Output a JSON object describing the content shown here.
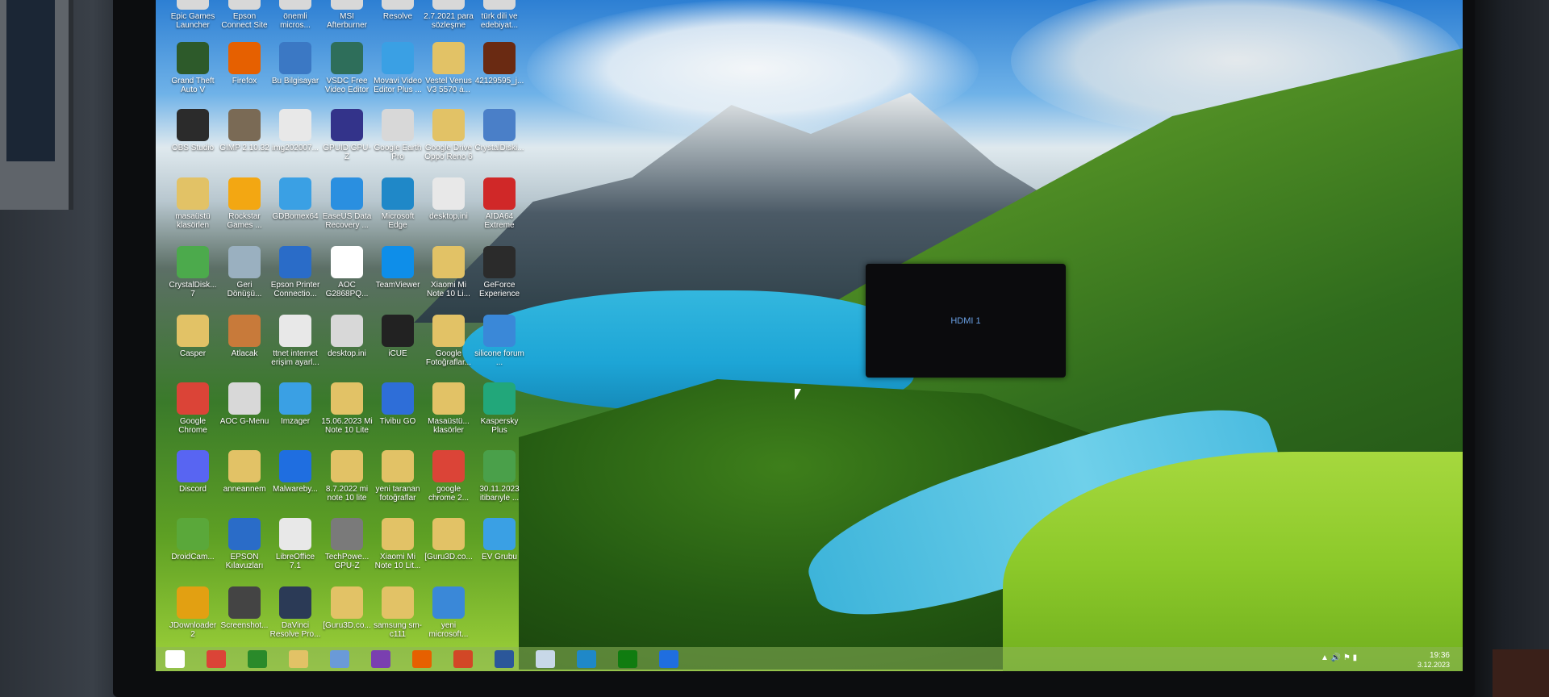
{
  "osd": {
    "label": "HDMI 1"
  },
  "taskbar": {
    "time": "19:36",
    "date": "3.12.2023",
    "pinned": [
      "start",
      "chrome",
      "store",
      "explorer",
      "control-panel",
      "onenote",
      "firefox",
      "powerpoint",
      "word",
      "notepad",
      "edge",
      "xbox",
      "malwarebytes"
    ]
  },
  "colors": {
    "osd_text": "#6aa0e4",
    "taskbar": "#8cb45a"
  },
  "icons": [
    {
      "col": 0,
      "row": 0,
      "label": "Epic Games Launcher"
    },
    {
      "col": 1,
      "row": 0,
      "label": "Epson Connect Site"
    },
    {
      "col": 2,
      "row": 0,
      "label": "önemli micros..."
    },
    {
      "col": 3,
      "row": 0,
      "label": "MSI Afterburner"
    },
    {
      "col": 4,
      "row": 0,
      "label": "Resolve"
    },
    {
      "col": 5,
      "row": 0,
      "label": "2.7.2021 para sözleşme"
    },
    {
      "col": 6,
      "row": 0,
      "label": "türk dili ve edebiyat..."
    },
    {
      "col": 0,
      "row": 1,
      "label": "Grand Theft Auto V",
      "color": "#2d5a2a"
    },
    {
      "col": 1,
      "row": 1,
      "label": "Firefox",
      "color": "#e66000"
    },
    {
      "col": 2,
      "row": 1,
      "label": "Bu Bilgisayar",
      "color": "#3b78c4"
    },
    {
      "col": 3,
      "row": 1,
      "label": "VSDC Free Video Editor",
      "color": "#2e6e5a"
    },
    {
      "col": 4,
      "row": 1,
      "label": "Movavi Video Editor Plus ...",
      "color": "#3aa0e4"
    },
    {
      "col": 5,
      "row": 1,
      "label": "Vestel Venus V3 5570 á...",
      "color": "#e2c266"
    },
    {
      "col": 6,
      "row": 1,
      "label": "42129595_j...",
      "color": "#6a2a12"
    },
    {
      "col": 0,
      "row": 2,
      "label": "OBS Studio",
      "color": "#2b2b2b"
    },
    {
      "col": 1,
      "row": 2,
      "label": "GIMP 2.10.32",
      "color": "#7a6a55"
    },
    {
      "col": 2,
      "row": 2,
      "label": "img202007...",
      "color": "#e8e8e8"
    },
    {
      "col": 3,
      "row": 2,
      "label": "GPUID GPU-Z",
      "color": "#33338a"
    },
    {
      "col": 4,
      "row": 2,
      "label": "Google Earth Pro",
      "color": "#d8d8d8"
    },
    {
      "col": 5,
      "row": 2,
      "label": "Google Drive Oppo Reno 6",
      "color": "#e2c266"
    },
    {
      "col": 6,
      "row": 2,
      "label": "CrystalDiski...",
      "color": "#4a7fc8"
    },
    {
      "col": 0,
      "row": 3,
      "label": "masaüstü klasörlen",
      "color": "#e2c266"
    },
    {
      "col": 1,
      "row": 3,
      "label": "Rockstar Games ...",
      "color": "#f3a712"
    },
    {
      "col": 2,
      "row": 3,
      "label": "GDBomex64",
      "color": "#3aa0e4"
    },
    {
      "col": 3,
      "row": 3,
      "label": "EaseUS Data Recovery ...",
      "color": "#2a8fe0"
    },
    {
      "col": 4,
      "row": 3,
      "label": "Microsoft Edge",
      "color": "#1f88c8"
    },
    {
      "col": 5,
      "row": 3,
      "label": "desktop.ini",
      "color": "#e8e8e8"
    },
    {
      "col": 6,
      "row": 3,
      "label": "AIDA64 Extreme",
      "color": "#d02828"
    },
    {
      "col": 0,
      "row": 4,
      "label": "CrystalDisk... 7",
      "color": "#4caa4c"
    },
    {
      "col": 1,
      "row": 4,
      "label": "Geri Dönüşü...",
      "color": "#9ab0c0"
    },
    {
      "col": 2,
      "row": 4,
      "label": "Epson Printer Connectio...",
      "color": "#2a6cc8"
    },
    {
      "col": 3,
      "row": 4,
      "label": "AOC G2868PQ...",
      "color": "#ffffff"
    },
    {
      "col": 4,
      "row": 4,
      "label": "TeamViewer",
      "color": "#0e8ee9"
    },
    {
      "col": 5,
      "row": 4,
      "label": "Xiaomi Mi Note 10 Li...",
      "color": "#e2c266"
    },
    {
      "col": 6,
      "row": 4,
      "label": "GeForce Experience",
      "color": "#2b2b2b"
    },
    {
      "col": 0,
      "row": 5,
      "label": "Casper",
      "color": "#e2c266"
    },
    {
      "col": 1,
      "row": 5,
      "label": "Atlacak",
      "color": "#c87a3a"
    },
    {
      "col": 2,
      "row": 5,
      "label": "ttnet internet erişim ayarl...",
      "color": "#e8e8e8"
    },
    {
      "col": 3,
      "row": 5,
      "label": "desktop.ini",
      "color": "#d8d8d8"
    },
    {
      "col": 4,
      "row": 5,
      "label": "iCUE",
      "color": "#222222"
    },
    {
      "col": 5,
      "row": 5,
      "label": "Google Fotoğraflar...",
      "color": "#e2c266"
    },
    {
      "col": 6,
      "row": 5,
      "label": "silicone forum ...",
      "color": "#3a88d8"
    },
    {
      "col": 0,
      "row": 6,
      "label": "Google Chrome",
      "color": "#db4437"
    },
    {
      "col": 1,
      "row": 6,
      "label": "AOC G-Menu",
      "color": "#d8d8d8"
    },
    {
      "col": 2,
      "row": 6,
      "label": "Imzager",
      "color": "#3aa0e4"
    },
    {
      "col": 3,
      "row": 6,
      "label": "15.06.2023 Mi Note 10 Lite",
      "color": "#e2c266"
    },
    {
      "col": 4,
      "row": 6,
      "label": "Tivibu GO",
      "color": "#2e6ed8"
    },
    {
      "col": 5,
      "row": 6,
      "label": "Masaüstü... klasörler",
      "color": "#e2c266"
    },
    {
      "col": 6,
      "row": 6,
      "label": "Kaspersky Plus",
      "color": "#22a77a"
    },
    {
      "col": 0,
      "row": 7,
      "label": "Discord",
      "color": "#5865f2"
    },
    {
      "col": 1,
      "row": 7,
      "label": "anneannem",
      "color": "#e2c266"
    },
    {
      "col": 2,
      "row": 7,
      "label": "Malwareby...",
      "color": "#1f6ee0"
    },
    {
      "col": 3,
      "row": 7,
      "label": "8.7.2022 mi note 10 lite",
      "color": "#e2c266"
    },
    {
      "col": 4,
      "row": 7,
      "label": "yeni taranan fotoğraflar",
      "color": "#e2c266"
    },
    {
      "col": 5,
      "row": 7,
      "label": "google chrome 2...",
      "color": "#db4437"
    },
    {
      "col": 6,
      "row": 7,
      "label": "30.11.2023 itibarıyle ...",
      "color": "#4aa04a"
    },
    {
      "col": 0,
      "row": 8,
      "label": "DroidCam...",
      "color": "#5aa83a"
    },
    {
      "col": 1,
      "row": 8,
      "label": "EPSON Kılavuzları",
      "color": "#2a6cc8"
    },
    {
      "col": 2,
      "row": 8,
      "label": "LibreOffice 7.1",
      "color": "#e8e8e8"
    },
    {
      "col": 3,
      "row": 8,
      "label": "TechPowe... GPU-Z",
      "color": "#7a7a7a"
    },
    {
      "col": 4,
      "row": 8,
      "label": "Xiaomi Mi Note 10 Lit...",
      "color": "#e2c266"
    },
    {
      "col": 5,
      "row": 8,
      "label": "[Guru3D.co...",
      "color": "#e2c266"
    },
    {
      "col": 6,
      "row": 8,
      "label": "EV Grubu",
      "color": "#3aa0e4"
    },
    {
      "col": 0,
      "row": 9,
      "label": "JDownloader 2",
      "color": "#e2a012"
    },
    {
      "col": 1,
      "row": 9,
      "label": "Screenshot...",
      "color": "#444444"
    },
    {
      "col": 2,
      "row": 9,
      "label": "DaVinci Resolve Pro...",
      "color": "#2b3a56"
    },
    {
      "col": 3,
      "row": 9,
      "label": "[Guru3D.co...",
      "color": "#e2c266"
    },
    {
      "col": 4,
      "row": 9,
      "label": "samsung sm-c111",
      "color": "#e2c266"
    },
    {
      "col": 5,
      "row": 9,
      "label": "yeni microsoft...",
      "color": "#3a88d8"
    }
  ]
}
